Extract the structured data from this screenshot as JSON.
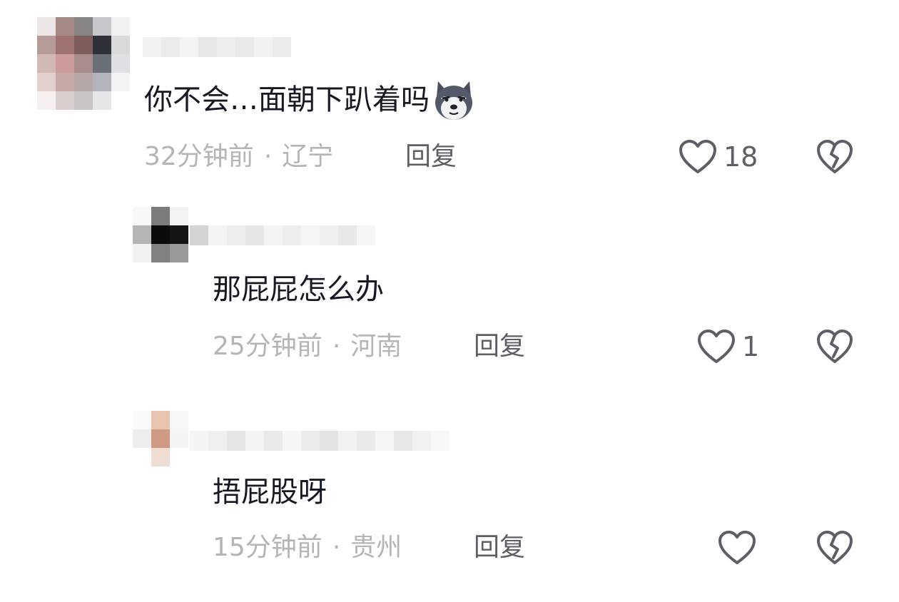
{
  "comments": [
    {
      "text": "你不会…面朝下趴着吗",
      "emoji": "husky-dog-emoji",
      "time": "32分钟前",
      "separator": "·",
      "location": "辽宁",
      "reply_label": "回复",
      "likes": "18",
      "like_icon": "heart-icon",
      "dislike_icon": "broken-heart-icon"
    },
    {
      "text": "那屁屁怎么办",
      "time": "25分钟前",
      "separator": "·",
      "location": "河南",
      "reply_label": "回复",
      "likes": "1",
      "like_icon": "heart-icon",
      "dislike_icon": "broken-heart-icon"
    },
    {
      "text": "捂屁股呀",
      "time": "15分钟前",
      "separator": "·",
      "location": "贵州",
      "reply_label": "回复",
      "likes": "",
      "like_icon": "heart-icon",
      "dislike_icon": "broken-heart-icon"
    }
  ],
  "colors": {
    "text": "#161823",
    "meta": "#b4b5b9",
    "action": "#5e5f66",
    "icon": "#5e5f66"
  }
}
